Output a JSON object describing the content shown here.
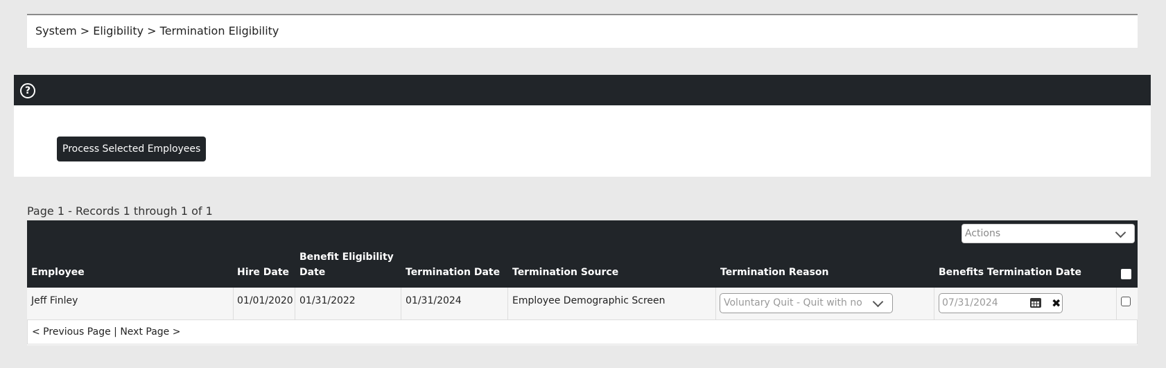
{
  "breadcrumb": "System > Eligibility > Termination Eligibility",
  "help_icon": "?",
  "process_button": "Process Selected Employees",
  "records_text": "Page 1 - Records 1 through 1 of 1",
  "actions": {
    "placeholder": "Actions"
  },
  "columns": {
    "employee": "Employee",
    "hire_date": "Hire Date",
    "benefit_eligibility_date_1": "Benefit Eligibility",
    "benefit_eligibility_date_2": "Date",
    "termination_date": "Termination Date",
    "termination_source": "Termination Source",
    "termination_reason": "Termination Reason",
    "benefits_termination_date": "Benefits Termination Date"
  },
  "rows": [
    {
      "employee": "Jeff Finley",
      "hire_date": "01/01/2020",
      "benefit_eligibility_date": "01/31/2022",
      "termination_date": "01/31/2024",
      "termination_source": "Employee Demographic Screen",
      "termination_reason": "Voluntary Quit - Quit with no ...",
      "benefits_termination_date": "07/31/2024",
      "selected": false
    }
  ],
  "pager": {
    "previous": "< Previous Page",
    "separator": "|",
    "next": "Next Page >"
  },
  "icons": {
    "clear": "✖"
  },
  "colors": {
    "header_bg": "#212529",
    "page_bg": "#e9e9e9"
  }
}
